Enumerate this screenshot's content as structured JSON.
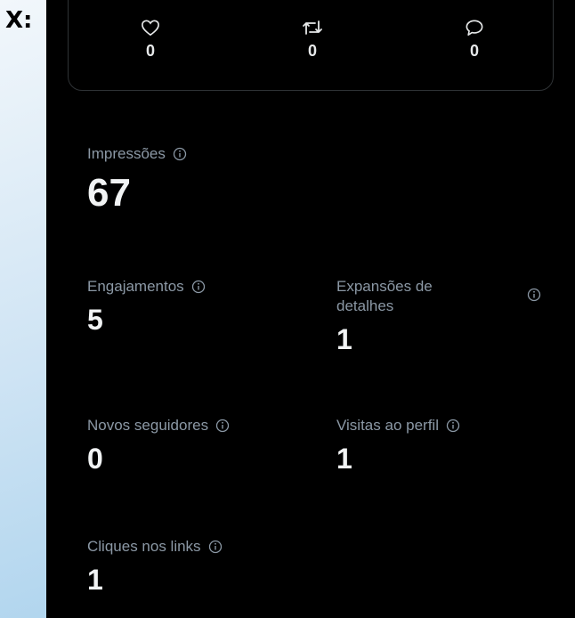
{
  "side_label": "X:",
  "engagement": {
    "likes": "0",
    "reposts": "0",
    "replies": "0"
  },
  "metrics": {
    "impressions": {
      "label": "Impressões",
      "value": "67"
    },
    "engagements": {
      "label": "Engajamentos",
      "value": "5"
    },
    "detail_expands": {
      "label": "Expansões de detalhes",
      "value": "1"
    },
    "new_followers": {
      "label": "Novos seguidores",
      "value": "0"
    },
    "profile_visits": {
      "label": "Visitas ao perfil",
      "value": "1"
    },
    "link_clicks": {
      "label": "Cliques nos links",
      "value": "1"
    }
  },
  "colors": {
    "background": "#000000",
    "label": "#8b98a5",
    "value": "#f1f3f4",
    "border": "#2f3336"
  },
  "icons": [
    "heart-icon",
    "repost-icon",
    "reply-icon",
    "info-icon"
  ]
}
